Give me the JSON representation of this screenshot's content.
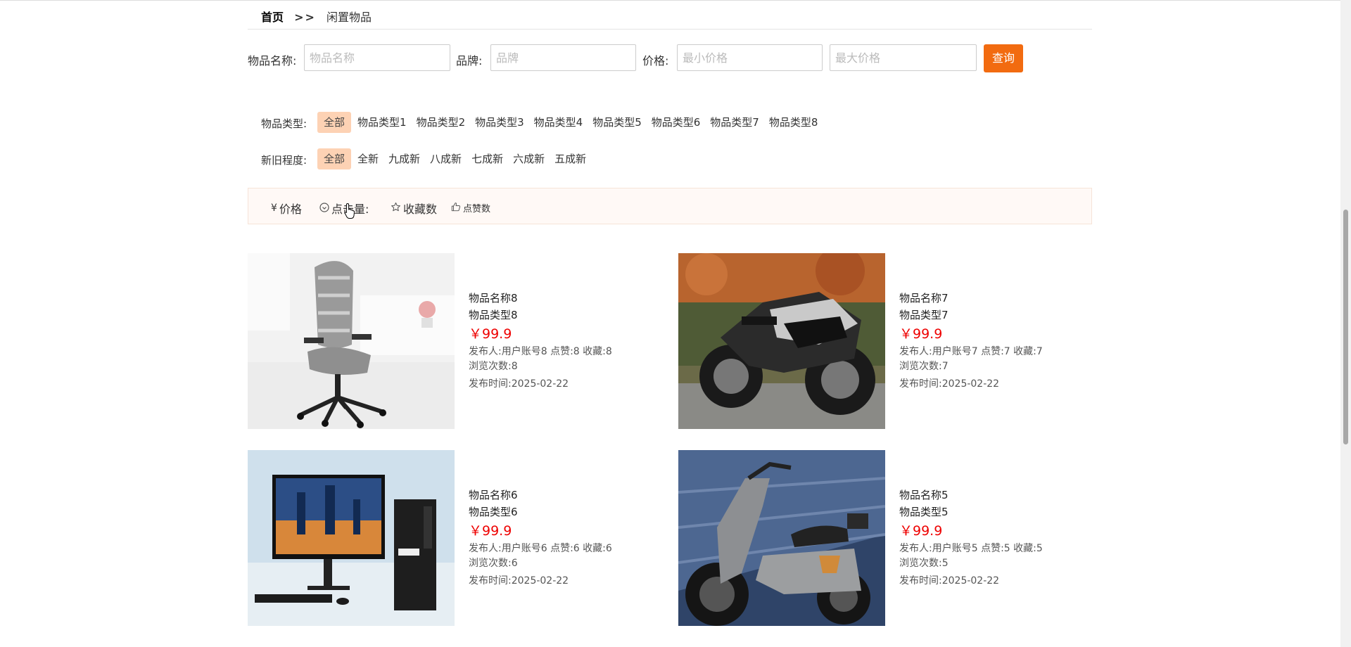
{
  "breadcrumb": {
    "home": "首页",
    "separator": ">>",
    "current": "闲置物品"
  },
  "search": {
    "name_label": "物品名称:",
    "name_placeholder": "物品名称",
    "brand_label": "品牌:",
    "brand_placeholder": "品牌",
    "price_label": "价格:",
    "min_price_placeholder": "最小价格",
    "max_price_placeholder": "最大价格",
    "query_button": "查询"
  },
  "filters": {
    "type": {
      "label": "物品类型:",
      "options": [
        "全部",
        "物品类型1",
        "物品类型2",
        "物品类型3",
        "物品类型4",
        "物品类型5",
        "物品类型6",
        "物品类型7",
        "物品类型8"
      ],
      "selected": "全部"
    },
    "condition": {
      "label": "新旧程度:",
      "options": [
        "全部",
        "全新",
        "九成新",
        "八成新",
        "七成新",
        "六成新",
        "五成新"
      ],
      "selected": "全部"
    }
  },
  "sort": {
    "price": {
      "icon": "yen-icon",
      "label": "价格"
    },
    "clicks": {
      "icon": "clock-icon",
      "label": "点击量:"
    },
    "favorites": {
      "icon": "star-icon",
      "label": "收藏数"
    },
    "likes": {
      "icon": "thumbs-up-icon",
      "label": "点赞数"
    }
  },
  "products": [
    {
      "name": "物品名称8",
      "type": "物品类型8",
      "price": "￥99.9",
      "meta": "发布人:用户账号8   点赞:8   收藏:8",
      "views": "浏览次数:8",
      "time": "发布时间:2025-02-22",
      "image": "office-chair"
    },
    {
      "name": "物品名称7",
      "type": "物品类型7",
      "price": "￥99.9",
      "meta": "发布人:用户账号7   点赞:7   收藏:7",
      "views": "浏览次数:7",
      "time": "发布时间:2025-02-22",
      "image": "motorcycle"
    },
    {
      "name": "物品名称6",
      "type": "物品类型6",
      "price": "￥99.9",
      "meta": "发布人:用户账号6   点赞:6   收藏:6",
      "views": "浏览次数:6",
      "time": "发布时间:2025-02-22",
      "image": "desktop-computer"
    },
    {
      "name": "物品名称5",
      "type": "物品类型5",
      "price": "￥99.9",
      "meta": "发布人:用户账号5   点赞:5   收藏:5",
      "views": "浏览次数:5",
      "time": "发布时间:2025-02-22",
      "image": "electric-scooter"
    }
  ],
  "colors": {
    "accent": "#f26b10",
    "price": "#ee0000",
    "active_filter": "#fdd2b4",
    "sortbar_bg": "#fff9f6"
  }
}
